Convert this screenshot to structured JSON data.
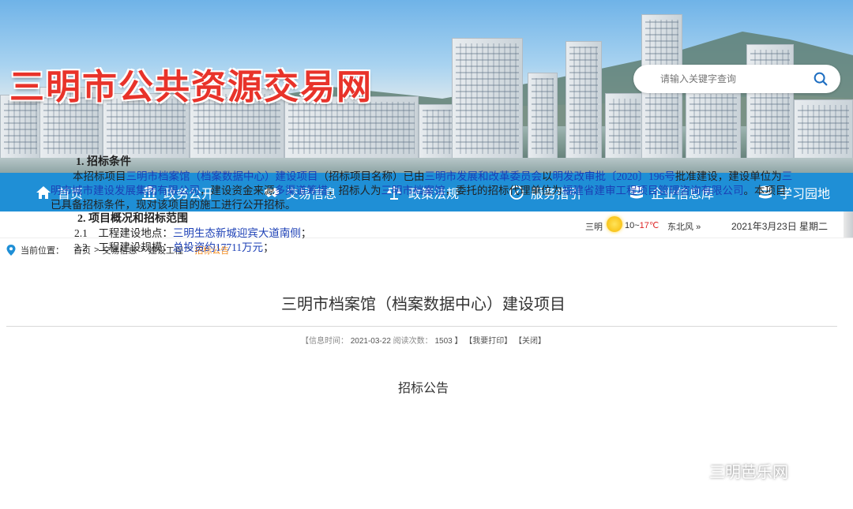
{
  "site": {
    "title": "三明市公共资源交易网"
  },
  "search": {
    "placeholder": "请输入关键字查询"
  },
  "nav": [
    {
      "label": "首页",
      "icon": "home-icon"
    },
    {
      "label": "政务公开",
      "icon": "bank-icon"
    },
    {
      "label": "交易信息",
      "icon": "handshake-icon"
    },
    {
      "label": "政策法规",
      "icon": "scales-icon"
    },
    {
      "label": "服务指引",
      "icon": "compass-icon"
    },
    {
      "label": "企业信息库",
      "icon": "database-icon"
    },
    {
      "label": "学习园地",
      "icon": "database-icon"
    }
  ],
  "weather": {
    "city": "三明",
    "temp_low": "10~",
    "temp_high": "17℃",
    "wind": "东北风",
    "more": "»",
    "date": "2021年3月23日 星期二"
  },
  "breadcrumb": {
    "label": "当前位置：",
    "items": [
      "首页",
      "交易信息",
      "建设工程"
    ],
    "current": "招标公告",
    "sep": ">"
  },
  "article": {
    "title": "三明市档案馆（档案数据中心）建设项目",
    "meta_open": "【信息时间：",
    "date": "2021-03-22",
    "views_label": "阅读次数：",
    "views": "1503",
    "meta_close": "】",
    "print": "【我要打印】",
    "close": "【关闭】",
    "subtitle": "招标公告",
    "section1": "1.  招标条件",
    "p1": {
      "t1": "本招标项目",
      "l1": "三明市档案馆（档案数据中心）建设项目",
      "t2": "（招标项目名称）已由",
      "l2": "三明市发展和改革委员会",
      "t3": "以",
      "l3": "明发改审批〔2020〕196号",
      "t4": "批准建设，建设单位为",
      "l4": "三明市城市建设发展集团有限公司",
      "t5": "，建设资金来源",
      "l5": "多渠道筹措",
      "t6": "，招标人为",
      "l6": "三明市档案馆",
      "t7": "，委托的招标代理单位为",
      "l7": "福建省建审工程项目管理咨询有限公司",
      "t8": "。本项目已具备招标条件，现对该项目的施工进行公开招标。"
    },
    "section2": "2.  项目概况和招标范围",
    "item21_num": "2.1",
    "item21_label": "工程建设地点：",
    "item21_val": "三明生态新城迎宾大道南侧",
    "item21_end": "；",
    "item22_num": "2.2",
    "item22_label": "工程建设规模：",
    "item22_val": "总投资约17711万元",
    "item22_end": "；"
  },
  "watermark": {
    "text": "三明芭乐网"
  },
  "colors": {
    "nav": "#1f8fd6",
    "title_red": "#e8332a",
    "link": "#1b3fb5",
    "current_crumb": "#f28a1c"
  }
}
